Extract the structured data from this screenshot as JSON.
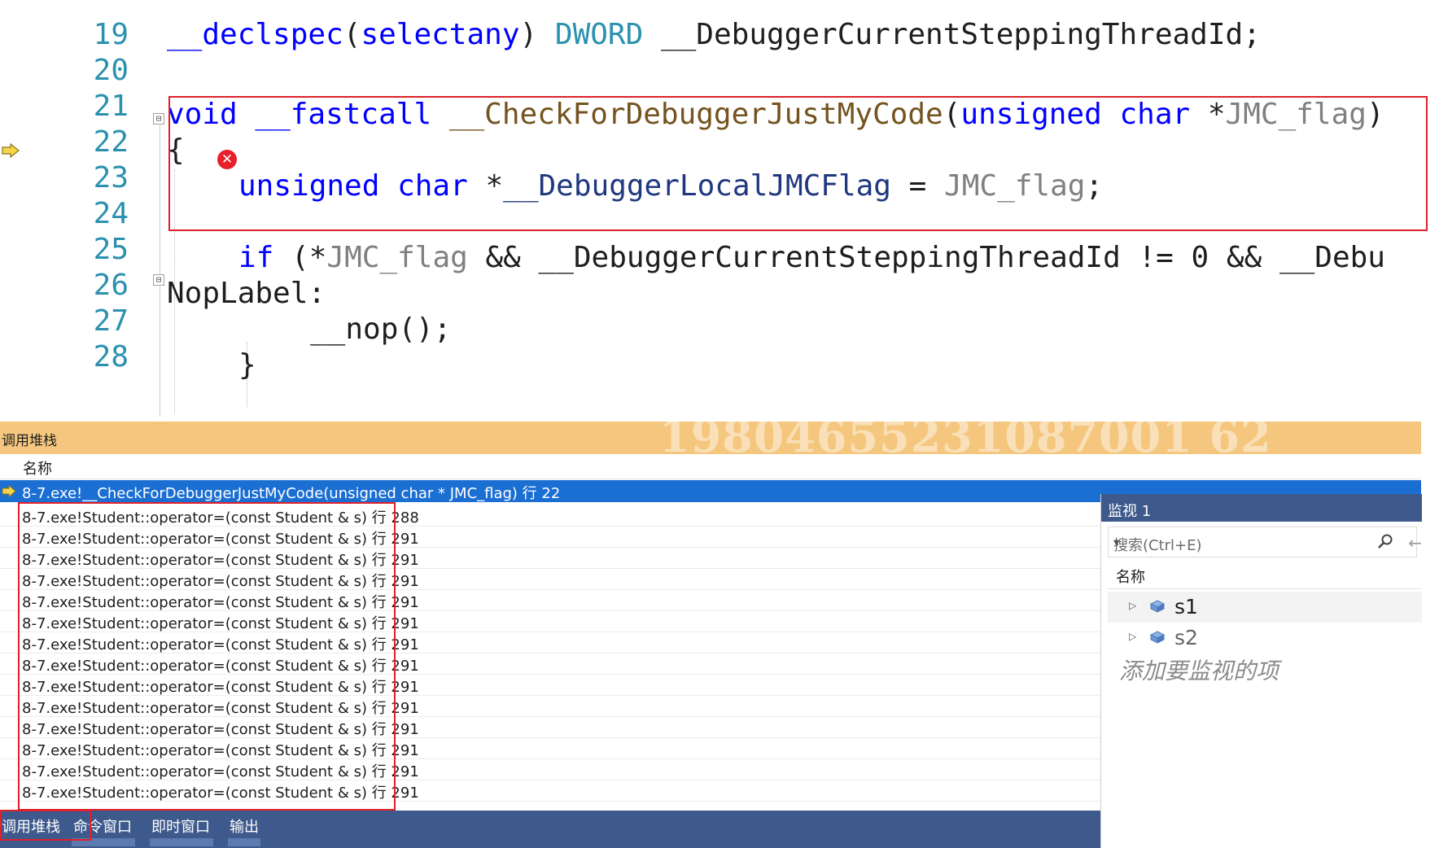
{
  "editor": {
    "lines": [
      {
        "num": "19"
      },
      {
        "num": "20"
      },
      {
        "num": "21"
      },
      {
        "num": "22"
      },
      {
        "num": "23"
      },
      {
        "num": "24"
      },
      {
        "num": "25"
      },
      {
        "num": "26"
      },
      {
        "num": "27"
      },
      {
        "num": "28"
      }
    ],
    "code": {
      "l19": [
        "__declspec",
        "(",
        "selectany",
        ")",
        "DWORD",
        "__DebuggerCurrentSteppingThreadId;"
      ],
      "l21": [
        "void",
        "__fastcall",
        "__CheckForDebuggerJustMyCode",
        "(",
        "unsigned",
        "char",
        "*",
        "JMC_flag",
        ")"
      ],
      "l22": "{",
      "l23": [
        "unsigned",
        "char",
        "*",
        "__DebuggerLocalJMCFlag",
        "=",
        "JMC_flag",
        ";"
      ],
      "l25": [
        "if",
        "(*",
        "JMC_flag",
        "&&",
        "__DebuggerCurrentSteppingThreadId",
        "!=",
        "0",
        "&&",
        "__Debu"
      ],
      "l26": "NopLabel:",
      "l27": "__nop();",
      "l28": "}"
    },
    "fold_glyph": "⊟",
    "error_glyph": "✕",
    "colors": {
      "keyword": "#0000ff",
      "type": "#2b91af",
      "function": "#74531f",
      "param": "#808080",
      "highlight_box": "#e0202a"
    }
  },
  "callstack": {
    "title": "调用堆栈",
    "watermark": "19804655231087001 62",
    "column_header": "名称",
    "current_frame": "8-7.exe!__CheckForDebuggerJustMyCode(unsigned char * JMC_flag) 行 22",
    "frames": [
      "8-7.exe!Student::operator=(const Student & s) 行 288",
      "8-7.exe!Student::operator=(const Student & s) 行 291",
      "8-7.exe!Student::operator=(const Student & s) 行 291",
      "8-7.exe!Student::operator=(const Student & s) 行 291",
      "8-7.exe!Student::operator=(const Student & s) 行 291",
      "8-7.exe!Student::operator=(const Student & s) 行 291",
      "8-7.exe!Student::operator=(const Student & s) 行 291",
      "8-7.exe!Student::operator=(const Student & s) 行 291",
      "8-7.exe!Student::operator=(const Student & s) 行 291",
      "8-7.exe!Student::operator=(const Student & s) 行 291",
      "8-7.exe!Student::operator=(const Student & s) 行 291",
      "8-7.exe!Student::operator=(const Student & s) 行 291",
      "8-7.exe!Student::operator=(const Student & s) 行 291",
      "8-7.exe!Student::operator=(const Student & s) 行 291"
    ],
    "current_color": "#1c6fd2",
    "title_color": "#f5c77e"
  },
  "watch": {
    "title": "监视 1",
    "search_placeholder": "搜索(Ctrl+E)",
    "search_icon": "search-icon",
    "column_header": "名称",
    "items": [
      {
        "name": "s1"
      },
      {
        "name": "s2"
      }
    ],
    "add_hint": "添加要监视的项",
    "expand_glyph": "▷"
  },
  "tabs": {
    "items": [
      "调用堆栈",
      "命令窗口",
      "即时窗口",
      "输出"
    ],
    "active": "调用堆栈"
  }
}
